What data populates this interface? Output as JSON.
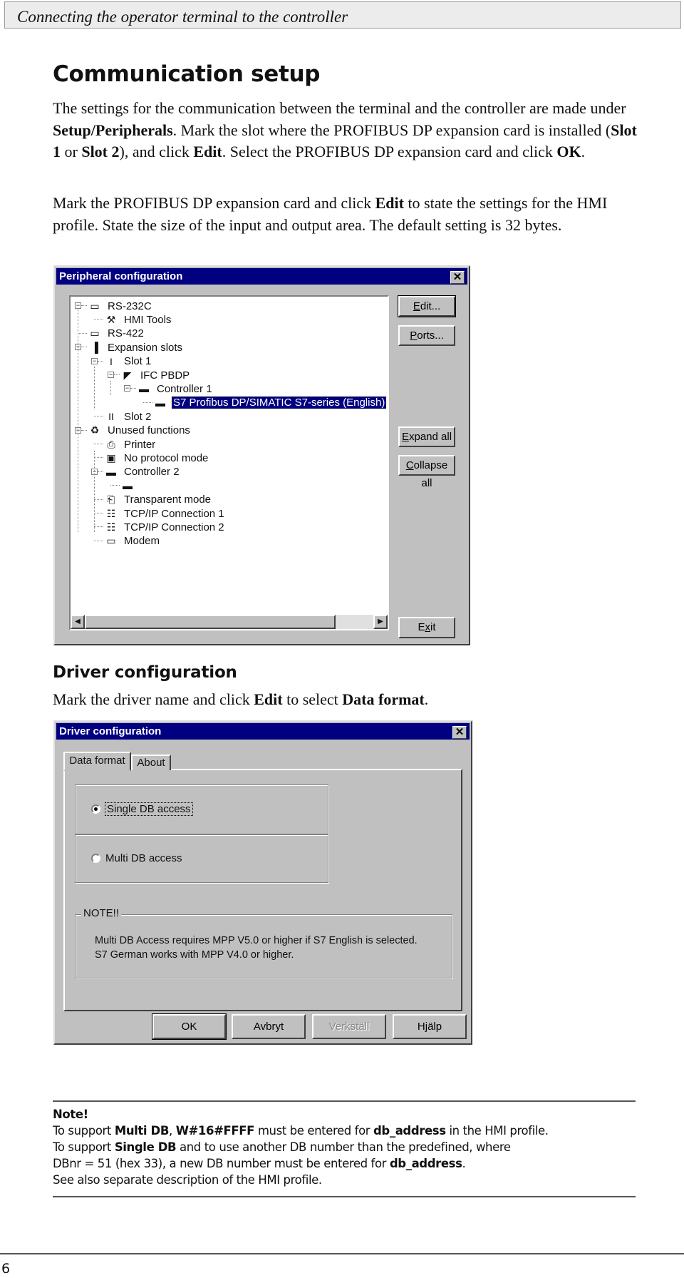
{
  "running_header": "Connecting the operator terminal to the controller",
  "section1": {
    "title": "Communication setup",
    "paragraph1": [
      {
        "t": "The settings for the communication between the terminal and the controller are made under "
      },
      {
        "t": "Setup/Peripherals",
        "b": true
      },
      {
        "t": ". Mark the slot where the PROFIBUS DP expansion card is installed ("
      },
      {
        "t": "Slot 1",
        "b": true
      },
      {
        "t": " or "
      },
      {
        "t": "Slot 2",
        "b": true
      },
      {
        "t": "), and click "
      },
      {
        "t": "Edit",
        "b": true
      },
      {
        "t": ". Select the PROFIBUS DP expan­sion card and click "
      },
      {
        "t": "OK",
        "b": true
      },
      {
        "t": "."
      }
    ],
    "paragraph2": [
      {
        "t": "Mark the PROFIBUS DP expansion card and click "
      },
      {
        "t": "Edit",
        "b": true
      },
      {
        "t": " to state the settings for the HMI profile. State the size of the input and output area. The default setting is 32 bytes."
      }
    ]
  },
  "peripheral_dialog": {
    "title": "Peripheral configuration",
    "close": "✕",
    "tree": [
      {
        "label": "RS-232C",
        "icon": "serial-port-icon",
        "glyph": "▭",
        "level": 0,
        "expander": "−"
      },
      {
        "label": "HMI Tools",
        "icon": "wrench-icon",
        "glyph": "⚒",
        "level": 1
      },
      {
        "label": "RS-422",
        "icon": "serial-port-icon",
        "glyph": "▭",
        "level": 0
      },
      {
        "label": "Expansion slots",
        "icon": "expansion-slots-icon",
        "glyph": "▐",
        "level": 0,
        "expander": "−"
      },
      {
        "label": "Slot 1",
        "icon": "slot-1-icon",
        "glyph": "I",
        "level": 1,
        "expander": "−"
      },
      {
        "label": "IFC PBDP",
        "icon": "expansion-card-icon",
        "glyph": "◤",
        "level": 2,
        "expander": "−"
      },
      {
        "label": "Controller 1",
        "icon": "controller-icon",
        "glyph": "▬",
        "level": 3,
        "expander": "−"
      },
      {
        "label": "S7 Profibus DP/SIMATIC S7-series (English)",
        "icon": "controller-driver-icon",
        "glyph": "▬",
        "level": 4,
        "selected": true
      },
      {
        "label": "Slot 2",
        "icon": "slot-2-icon",
        "glyph": "II",
        "level": 1
      },
      {
        "label": "Unused functions",
        "icon": "recycle-bin-icon",
        "glyph": "♻",
        "level": 0,
        "expander": "−"
      },
      {
        "label": "Printer",
        "icon": "printer-icon",
        "glyph": "⎙",
        "level": 1
      },
      {
        "label": "No protocol mode",
        "icon": "no-protocol-icon",
        "glyph": "▣",
        "level": 1
      },
      {
        "label": "Controller 2",
        "icon": "controller-icon",
        "glyph": "▬",
        "level": 1,
        "expander": "−"
      },
      {
        "label": "",
        "icon": "controller-driver-icon",
        "glyph": "▬",
        "level": 2
      },
      {
        "label": "Transparent mode",
        "icon": "transparent-mode-icon",
        "glyph": "⎗",
        "level": 1
      },
      {
        "label": "TCP/IP Connection 1",
        "icon": "network-icon",
        "glyph": "☷",
        "level": 1
      },
      {
        "label": "TCP/IP Connection 2",
        "icon": "network-icon",
        "glyph": "☷",
        "level": 1
      },
      {
        "label": "Modem",
        "icon": "modem-icon",
        "glyph": "▭",
        "level": 1
      }
    ],
    "buttons": {
      "edit": {
        "mnemonic": "E",
        "rest": "dit..."
      },
      "ports": {
        "mnemonic": "P",
        "rest": "orts..."
      },
      "expand_all": {
        "mnemonic": "E",
        "rest": "xpand all"
      },
      "collapse_all": {
        "mnemonic": "C",
        "rest": "ollapse all"
      },
      "exit": {
        "pre": "E",
        "mnemonic": "x",
        "rest": "it"
      }
    },
    "scroll_left": "◀",
    "scroll_right": "▶"
  },
  "section2": {
    "title": "Driver configuration",
    "paragraph": [
      {
        "t": "Mark the driver name and click "
      },
      {
        "t": "Edit",
        "b": true
      },
      {
        "t": " to select "
      },
      {
        "t": "Data format",
        "b": true
      },
      {
        "t": "."
      }
    ]
  },
  "driver_dialog": {
    "title": "Driver configuration",
    "close": "✕",
    "tabs": [
      "Data format",
      "About"
    ],
    "active_tab": "Data format",
    "options": [
      {
        "label": "Single DB access",
        "checked": true
      },
      {
        "label": "Multi DB access",
        "checked": false
      }
    ],
    "note_legend": "NOTE!!",
    "note_lines": [
      "Multi DB Access requires MPP V5.0 or higher if S7 English is selected.",
      "S7 German works with MPP V4.0 or higher."
    ],
    "buttons": {
      "ok": "OK",
      "cancel": "Avbryt",
      "apply": "Verkställ",
      "help": "Hjälp"
    },
    "apply_disabled": true
  },
  "note_box": {
    "title": "Note!",
    "lines": [
      [
        {
          "t": "To support "
        },
        {
          "t": "Multi DB",
          "b": true
        },
        {
          "t": ", "
        },
        {
          "t": "W#16#FFFF",
          "b": true
        },
        {
          "t": " must be entered for "
        },
        {
          "t": "db_address",
          "b": true
        },
        {
          "t": " in the HMI profile."
        }
      ],
      [
        {
          "t": "To support "
        },
        {
          "t": "Single DB",
          "b": true
        },
        {
          "t": " and to use another DB number than the predefined, where"
        }
      ],
      [
        {
          "t": "DBnr = 51 (hex 33), a new DB number must be entered for "
        },
        {
          "t": "db_address",
          "b": true
        },
        {
          "t": "."
        }
      ],
      [
        {
          "t": "See also separate description of the HMI profile."
        }
      ]
    ]
  },
  "page_number": "6"
}
